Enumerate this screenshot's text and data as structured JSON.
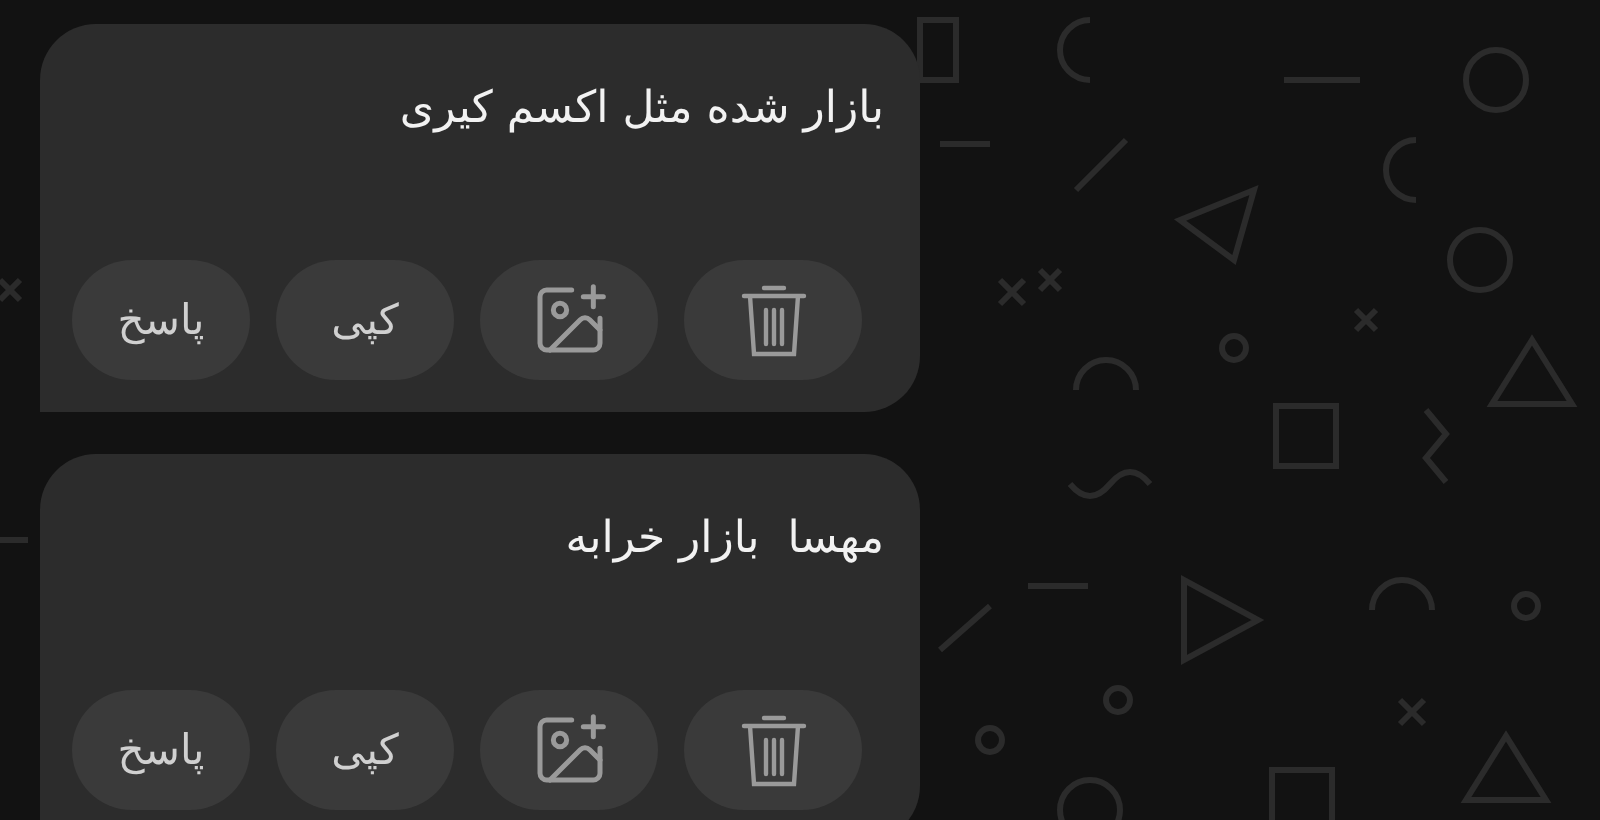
{
  "messages": [
    {
      "text": "بازار شده مثل اکسم کیری",
      "actions": [
        {
          "kind": "delete"
        },
        {
          "kind": "image"
        },
        {
          "kind": "copy",
          "label": "کپی"
        },
        {
          "kind": "reply",
          "label": "پاسخ"
        }
      ]
    },
    {
      "text": "مهسا  بازار خرابه",
      "actions": [
        {
          "kind": "delete"
        },
        {
          "kind": "image"
        },
        {
          "kind": "copy",
          "label": "کپی"
        },
        {
          "kind": "reply",
          "label": "پاسخ"
        }
      ]
    }
  ]
}
